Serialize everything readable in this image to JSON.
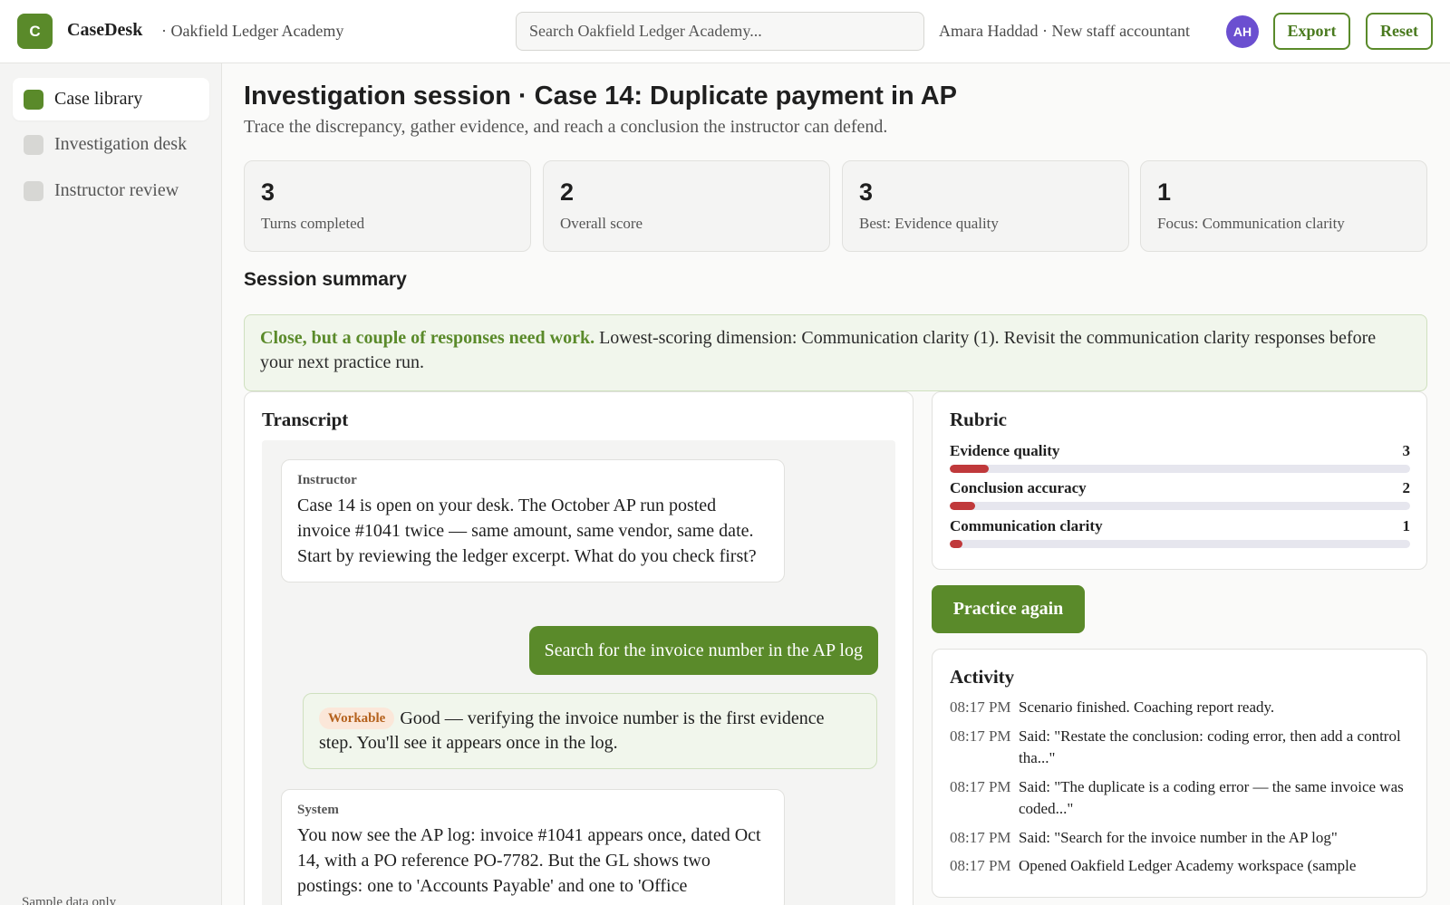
{
  "header": {
    "logo_letter": "C",
    "app_name": "CaseDesk",
    "org_name": "· Oakfield Ledger Academy",
    "search_placeholder": "Search Oakfield Ledger Academy...",
    "user_name": "Amara Haddad · New staff accountant",
    "avatar_initials": "AH",
    "export_label": "Export",
    "reset_label": "Reset"
  },
  "sidebar": {
    "items": [
      {
        "label": "Case library",
        "active": true
      },
      {
        "label": "Investigation desk",
        "active": false
      },
      {
        "label": "Instructor review",
        "active": false
      }
    ],
    "footer": "Sample data only"
  },
  "main": {
    "title": "Investigation session · Case 14: Duplicate payment in AP",
    "subtitle": "Trace the discrepancy, gather evidence, and reach a conclusion the instructor can defend.",
    "stats": [
      {
        "value": "3",
        "label": "Turns completed"
      },
      {
        "value": "2",
        "label": "Overall score"
      },
      {
        "value": "3",
        "label": "Best: Evidence quality"
      },
      {
        "value": "1",
        "label": "Focus: Communication clarity"
      }
    ],
    "summary_title": "Session summary",
    "summary_strong": "Close, but a couple of responses need work.",
    "summary_text": " Lowest-scoring dimension: Communication clarity (1). Revisit the communication clarity responses before your next practice run."
  },
  "transcript": {
    "title": "Transcript",
    "instructor": {
      "role": "Instructor",
      "text": "Case 14 is open on your desk. The October AP run posted invoice #1041 twice — same amount, same vendor, same date. Start by reviewing the ledger excerpt. What do you check first?"
    },
    "user_reply": "Search for the invoice number in the AP log",
    "feedback": {
      "tag": "Workable",
      "text": "Good — verifying the invoice number is the first evidence step. You'll see it appears once in the log."
    },
    "system": {
      "role": "System",
      "text": "You now see the AP log: invoice #1041 appears once, dated Oct 14, with a PO reference PO-7782. But the GL shows two postings: one to 'Accounts Payable' and one to 'Office"
    }
  },
  "rubric": {
    "title": "Rubric",
    "max_score": 5,
    "fill_color": "#c0393b",
    "items": [
      {
        "label": "Evidence quality",
        "score": 3
      },
      {
        "label": "Conclusion accuracy",
        "score": 2
      },
      {
        "label": "Communication clarity",
        "score": 1
      }
    ]
  },
  "practice_label": "Practice again",
  "activity": {
    "title": "Activity",
    "items": [
      {
        "time": "08:17 PM",
        "text": "Scenario finished. Coaching report ready."
      },
      {
        "time": "08:17 PM",
        "text": "Said: \"Restate the conclusion: coding error, then add a control tha...\""
      },
      {
        "time": "08:17 PM",
        "text": "Said: \"The duplicate is a coding error — the same invoice was coded...\""
      },
      {
        "time": "08:17 PM",
        "text": "Said: \"Search for the invoice number in the AP log\""
      },
      {
        "time": "08:17 PM",
        "text": "Opened Oakfield Ledger Academy workspace (sample"
      }
    ]
  },
  "colors": {
    "brand": "#5a8a2a",
    "avatar": "#6b4fd0",
    "tag_bg": "#fbe7d9",
    "tag_text": "#b5621d"
  }
}
